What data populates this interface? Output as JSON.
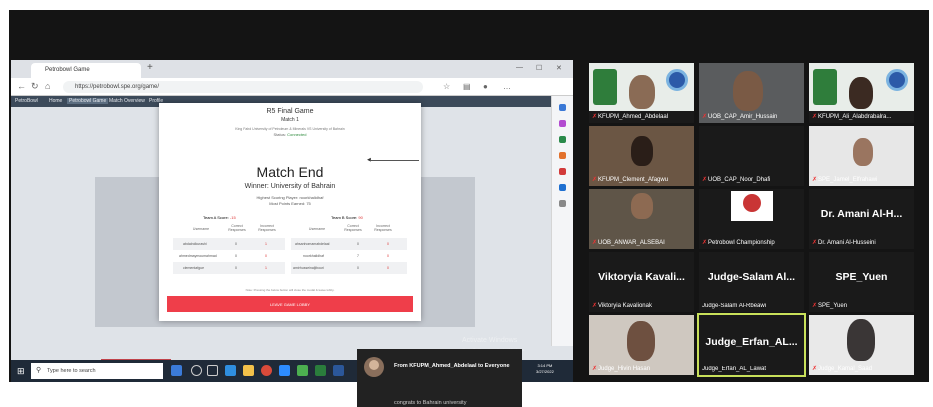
{
  "browser": {
    "tab_title": "Petrobowl Game",
    "url": "https://petrobowl.spe.org/game/",
    "nav_items": [
      "PetroBowl",
      "Home",
      "Petrobowl Game",
      "Match Overview",
      "Profile"
    ]
  },
  "modal": {
    "title": "R5 Final Game",
    "subtitle": "Match 1",
    "teams_line": "King Fahd University of Petroleum & Minerals VS University of Bahrain",
    "status_label": "Status:",
    "status_value": "Connected",
    "heading": "Match End",
    "winner": "Winner: University of Bahrain",
    "highest_scoring": "Highest Scoring Player: noorkhalidhaf",
    "most_points": "Most Points Earned: 75",
    "team_a_label": "Team A Score:",
    "team_a_score": "-15",
    "team_b_label": "Team B Score:",
    "team_b_score": "90",
    "columns": [
      "Username",
      "Correct Responses",
      "Incorrect Responses"
    ],
    "team_a_rows": [
      [
        "abdalrolkurashi",
        "0",
        "1"
      ],
      [
        "ahmedmaymoumahmad",
        "0",
        "0"
      ],
      [
        "clementafgue",
        "0",
        "1"
      ]
    ],
    "team_b_rows": [
      [
        "ahsanhomamabdelaal",
        "0",
        "0"
      ],
      [
        "noorkhalidhaf",
        "7",
        "0"
      ],
      [
        "amirhusseinaljibouri",
        "0",
        "0"
      ]
    ],
    "note": "Note: Pressing the below button will close the modal & leave lobby.",
    "leave_button": "LEAVE GAME LOBBY"
  },
  "taskbar": {
    "search_placeholder": "Type here to search",
    "clock_time": "3:14 PM",
    "clock_date": "3/27/2022"
  },
  "watermark": {
    "title": "Activate Windows",
    "subtitle": "Go to Settings to activate Windows."
  },
  "chat_toast": {
    "from": "From KFUPM_Ahmed_Abdelaal to Everyone",
    "message": "congrats to Bahrain university"
  },
  "participants": [
    {
      "name": "KFUPM_Ahmed_Abdelaal",
      "kind": "kfupm"
    },
    {
      "name": "UOB_CAP_Amir_Hussain",
      "kind": "room"
    },
    {
      "name": "KFUPM_Ali_Alabdrabalra...",
      "kind": "kfupm"
    },
    {
      "name": "KFUPM_Clement_Afagwu",
      "kind": "room"
    },
    {
      "name": "UOB_CAP_Noor_Dhafi",
      "kind": "dark"
    },
    {
      "name": "SPE_Jamel_Elfrahawi",
      "kind": "room"
    },
    {
      "name": "UOB_ANWAR_ALSEBAI",
      "kind": "room"
    },
    {
      "name": "Petrobowl Championship",
      "kind": "logo"
    },
    {
      "name": "Dr. Amani Al-Husseini",
      "kind": "text",
      "display": "Dr. Amani Al-H..."
    },
    {
      "name": "Viktoryia Kavalionak",
      "kind": "text",
      "display": "Viktoryia Kavali..."
    },
    {
      "name": "Judge-Salam Al-Rbeawi",
      "kind": "text",
      "display": "Judge-Salam Al..."
    },
    {
      "name": "SPE_Yuen",
      "kind": "text",
      "display": "SPE_Yuen"
    },
    {
      "name": "Judge_Hivin Hasan",
      "kind": "room"
    },
    {
      "name": "Judge_Erfan_AL_Lawat",
      "kind": "text",
      "display": "Judge_Erfan_AL...",
      "active": true
    },
    {
      "name": "Judge_Kamal_Saad",
      "kind": "room"
    }
  ]
}
